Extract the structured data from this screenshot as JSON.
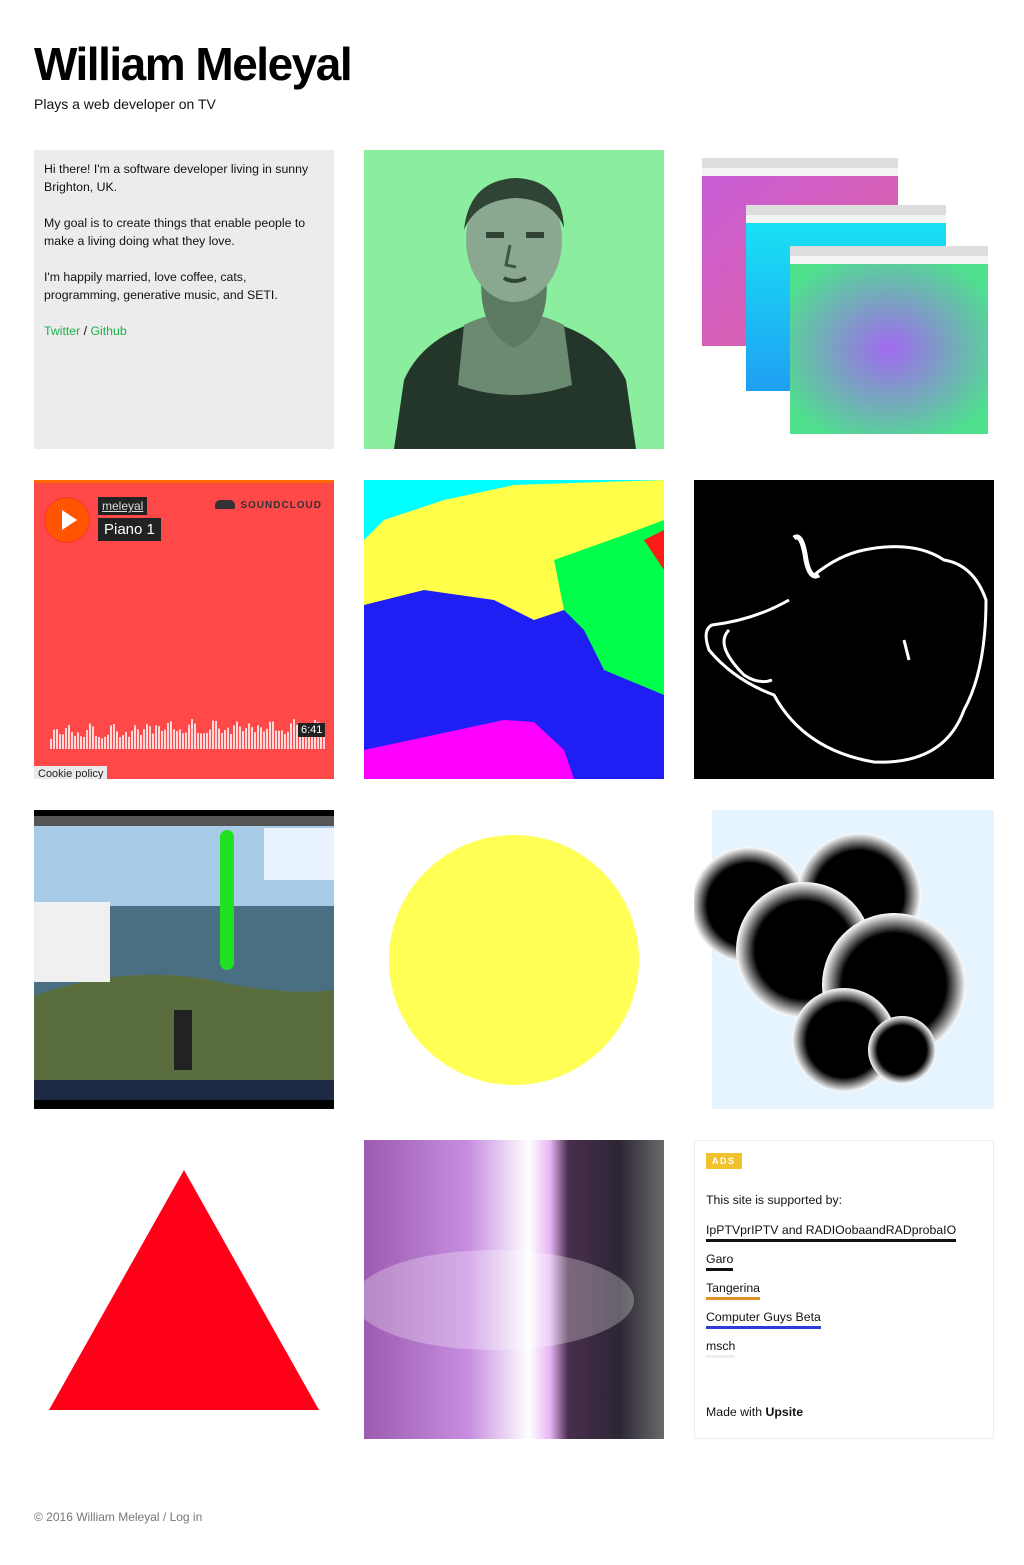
{
  "header": {
    "title": "William Meleyal",
    "subtitle": "Plays a web developer on TV"
  },
  "bio": {
    "p1": "Hi there! I'm a software developer living in sunny Brighton, UK.",
    "p2": "My goal is to create things that enable people to make a living doing what they love.",
    "p3": "I'm happily married, love coffee, cats, programming, generative music, and SETI.",
    "twitter": "Twitter",
    "separator": " / ",
    "github": "Github"
  },
  "soundcloud": {
    "user": "meleyal",
    "track": "Piano 1",
    "brand": "SOUNDCLOUD",
    "duration": "6:41",
    "cookie": "Cookie policy"
  },
  "ads": {
    "badge": "ADS",
    "intro": "This site is supported by:",
    "sponsors": [
      {
        "label": "IpPTVprIPTV and RADIOobaandRADprobaIO",
        "color": "#111111"
      },
      {
        "label": "Garo",
        "color": "#111111"
      },
      {
        "label": "Tangerina",
        "color": "#e0922a"
      },
      {
        "label": "Computer Guys Beta",
        "color": "#2d3ed6"
      },
      {
        "label": "msch",
        "color": "#eeeeee"
      }
    ],
    "made_with": "Made with ",
    "made_brand": "Upsite"
  },
  "footer": {
    "copyright": "© 2016 William Meleyal",
    "separator": " / ",
    "login": "Log in"
  },
  "colors": {
    "link_green": "#1ab24a",
    "soundcloud_bg": "#ff4848",
    "photo_bg": "#8aee9e",
    "ads_badge": "#f2c12e"
  }
}
